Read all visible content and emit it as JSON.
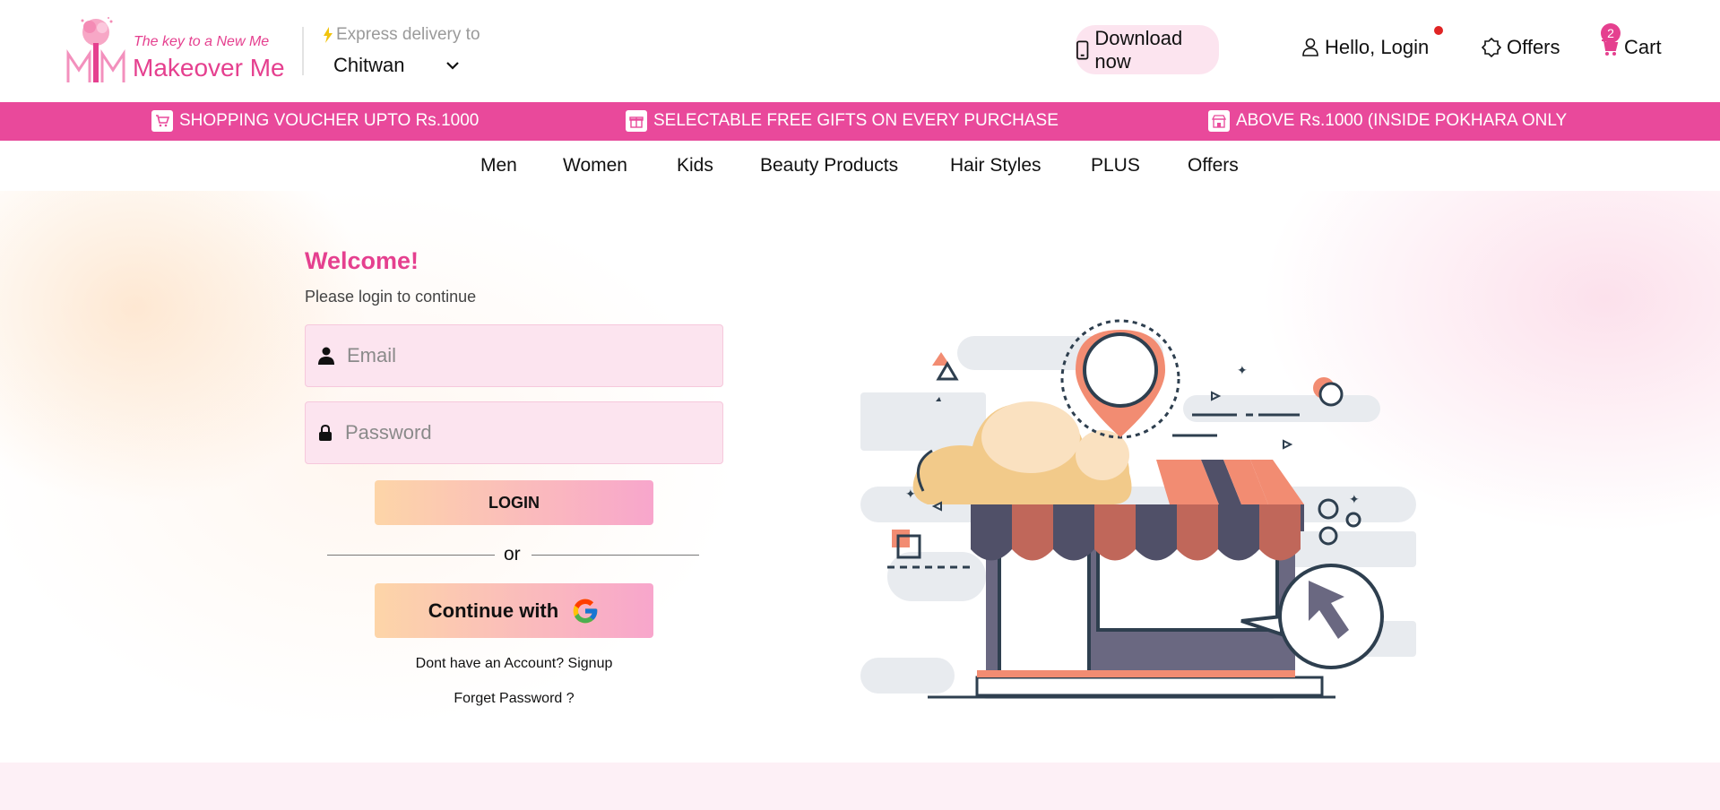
{
  "brand": {
    "tagline": "The key to a New Me",
    "name": "Makeover Me",
    "colors": {
      "primary": "#e9499b",
      "light_pink": "#fce4ef"
    }
  },
  "delivery": {
    "label": "Express delivery to",
    "selected_location": "Chitwan"
  },
  "header": {
    "download_label": "Download now",
    "login_label": "Hello, Login",
    "offers_label": "Offers",
    "cart_label": "Cart",
    "cart_count": "2"
  },
  "promo_bar": {
    "items": [
      {
        "icon": "cart-icon",
        "text": "SHOPPING VOUCHER UPTO Rs.1000"
      },
      {
        "icon": "gift-icon",
        "text": "SELECTABLE FREE GIFTS ON EVERY PURCHASE"
      },
      {
        "icon": "store-icon",
        "text": "ABOVE Rs.1000 (INSIDE POKHARA ONLY"
      }
    ]
  },
  "nav": {
    "items": [
      "Men",
      "Women",
      "Kids",
      "Beauty Products",
      "Hair Styles",
      "PLUS",
      "Offers"
    ]
  },
  "login_form": {
    "title": "Welcome!",
    "subtitle": "Please login to continue",
    "email_placeholder": "Email",
    "password_placeholder": "Password",
    "login_button": "LOGIN",
    "divider_text": "or",
    "google_button": "Continue with",
    "signup_text": "Dont have an Account? Signup",
    "forgot_text": "Forget Password ?"
  }
}
